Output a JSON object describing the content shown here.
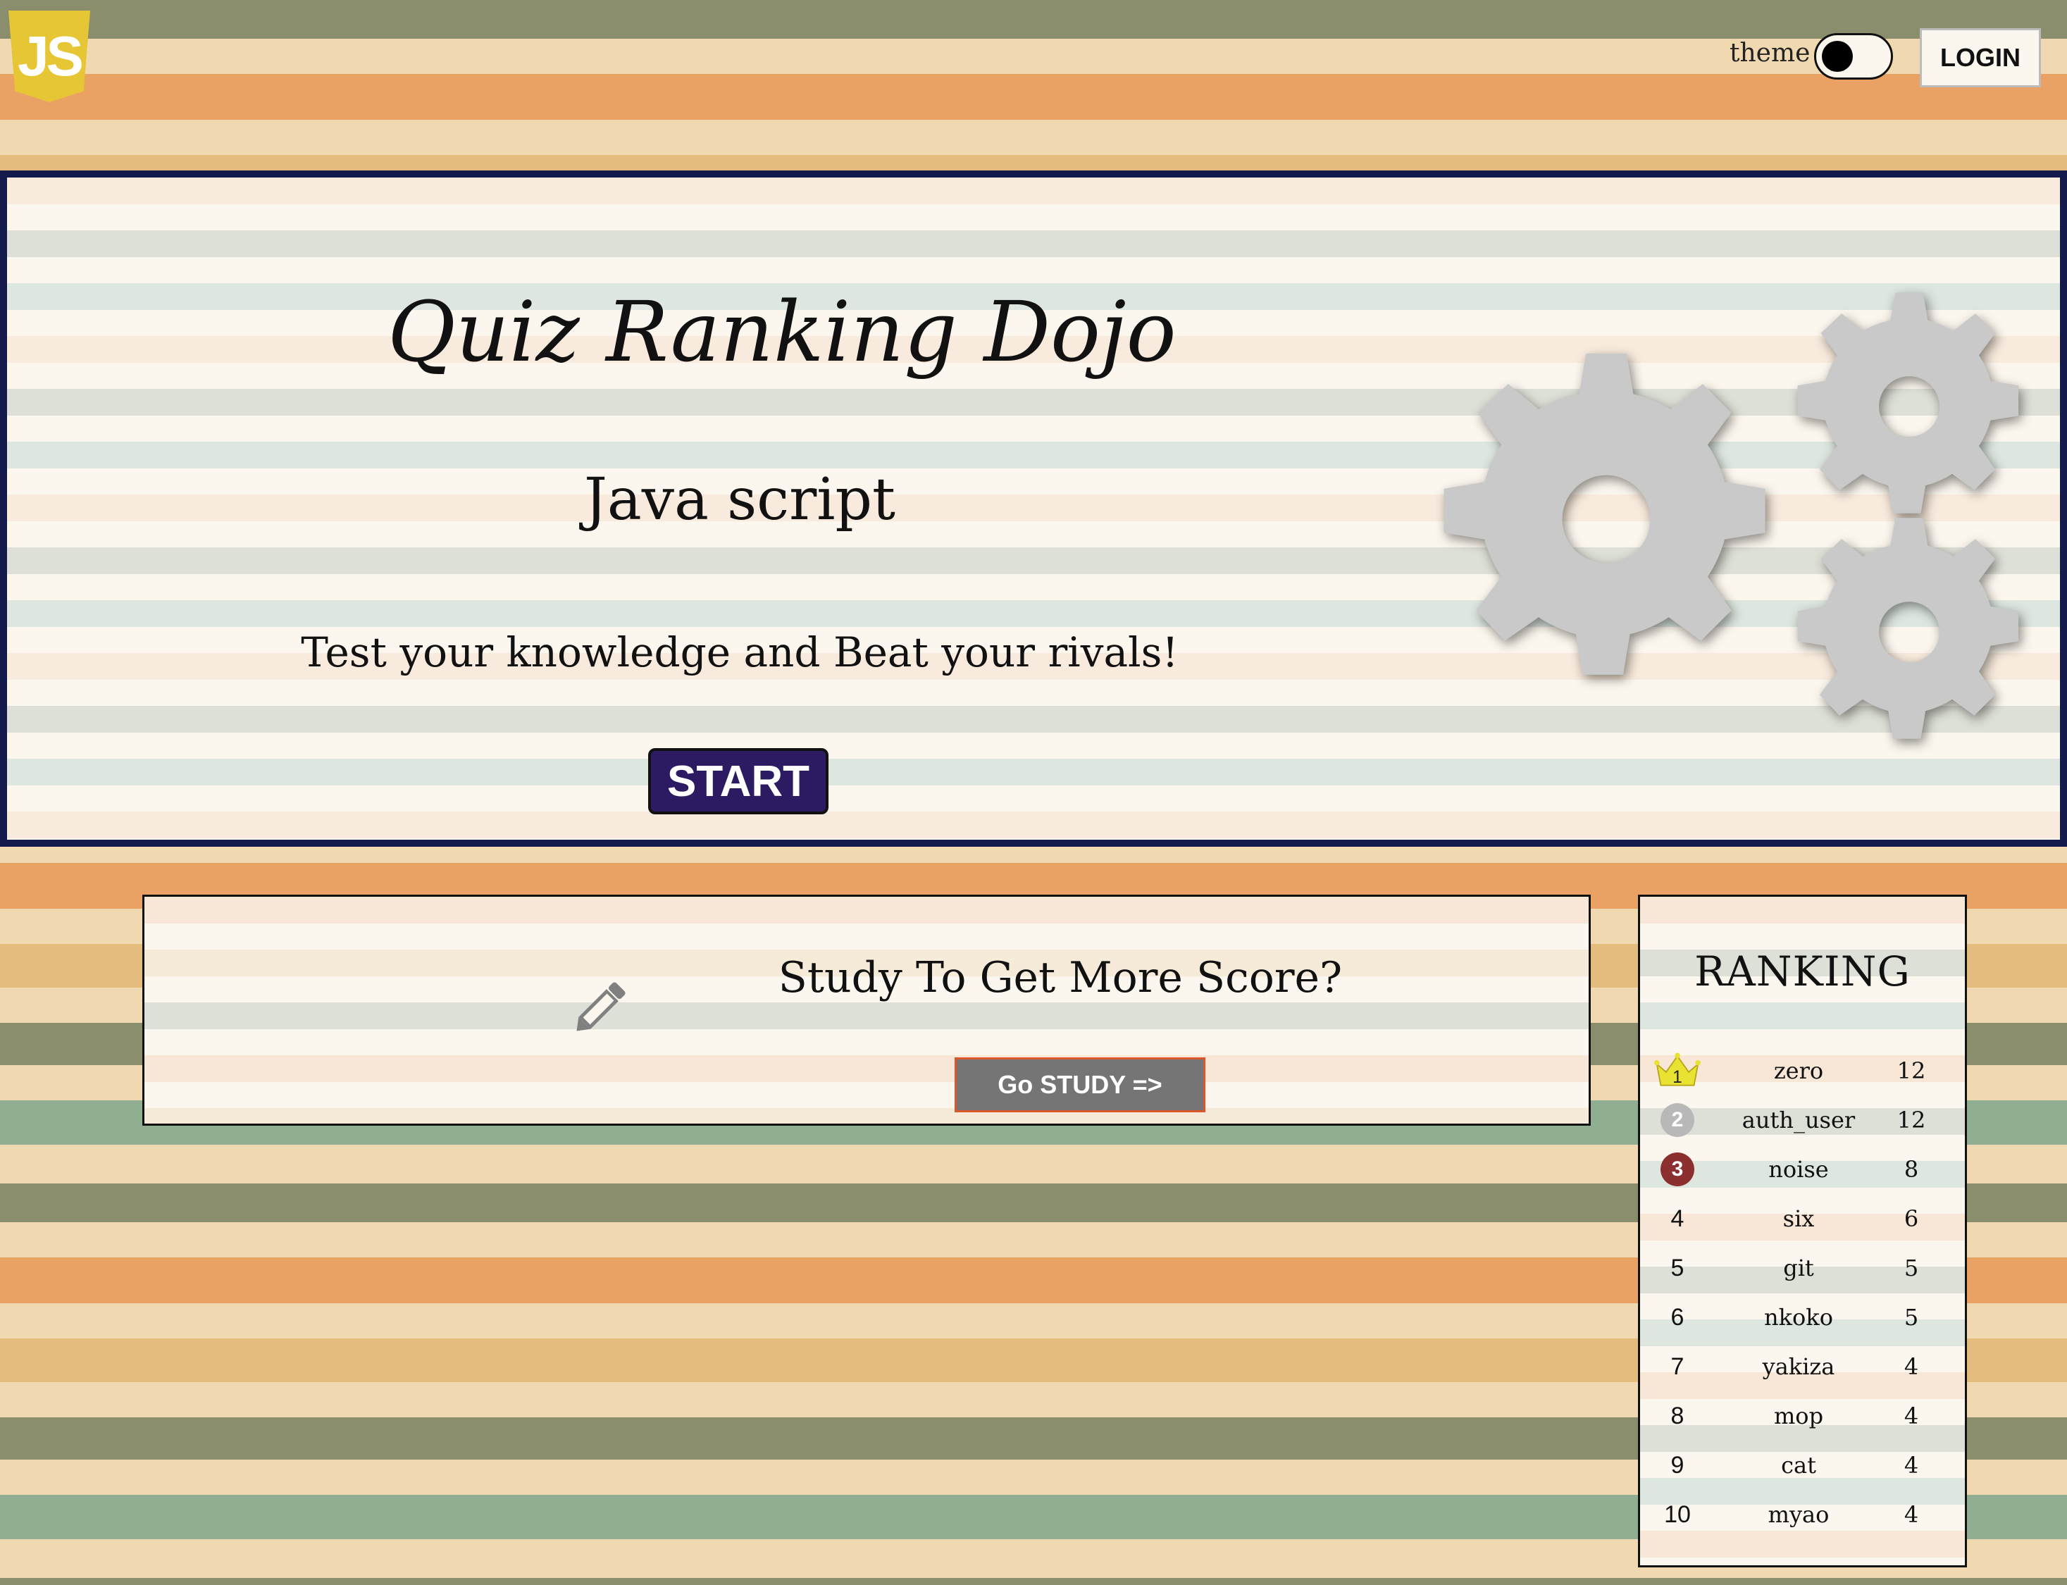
{
  "header": {
    "logo_text": "JS",
    "theme_label": "theme",
    "login_label": "LOGIN"
  },
  "hero": {
    "title": "Quiz Ranking Dojo",
    "subtitle": "Java script",
    "tagline": "Test your knowledge and Beat your rivals!",
    "start_label": "START"
  },
  "study": {
    "prompt": "Study To Get More Score?",
    "button_label": "Go STUDY =>"
  },
  "ranking": {
    "title": "RANKING",
    "rows": [
      {
        "rank": "1",
        "name": "zero",
        "score": "12"
      },
      {
        "rank": "2",
        "name": "auth_user",
        "score": "12"
      },
      {
        "rank": "3",
        "name": "noise",
        "score": "8"
      },
      {
        "rank": "4",
        "name": "six",
        "score": "6"
      },
      {
        "rank": "5",
        "name": "git",
        "score": "5"
      },
      {
        "rank": "6",
        "name": "nkoko",
        "score": "5"
      },
      {
        "rank": "7",
        "name": "yakiza",
        "score": "4"
      },
      {
        "rank": "8",
        "name": "mop",
        "score": "4"
      },
      {
        "rank": "9",
        "name": "cat",
        "score": "4"
      },
      {
        "rank": "10",
        "name": "myao",
        "score": "4"
      }
    ]
  },
  "colors": {
    "start_button": "#2c1a63",
    "hero_border": "#141a4c",
    "study_button": "#757575",
    "gold": "#e8e233",
    "silver": "#b8b8b8",
    "bronze": "#8b2f2f"
  },
  "icons": [
    "js-logo-icon",
    "gear-icon",
    "pencil-icon",
    "crown-icon",
    "silver-medal-icon",
    "bronze-medal-icon"
  ]
}
